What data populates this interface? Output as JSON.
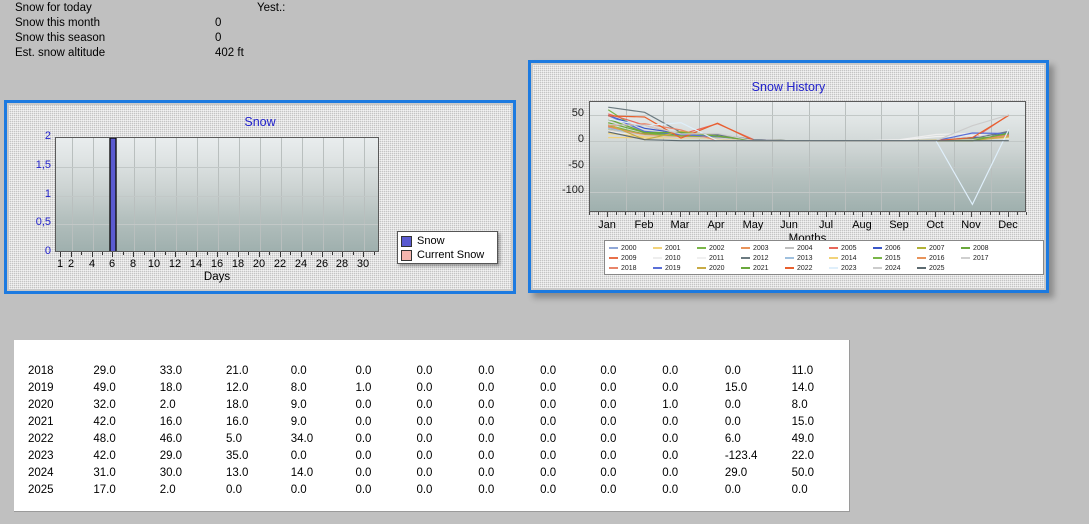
{
  "summary": {
    "rows": [
      {
        "label": "Snow for today",
        "value": "",
        "extra": "Yest.:"
      },
      {
        "label": "Snow this month",
        "value": "0",
        "extra": ""
      },
      {
        "label": "Snow this season",
        "value": "0",
        "extra": ""
      },
      {
        "label": "Est. snow altitude",
        "value": "402 ft",
        "extra": ""
      }
    ]
  },
  "snow_panel": {
    "title": "Snow",
    "legend": [
      {
        "label": "Snow",
        "color": "#5a5ad0"
      },
      {
        "label": "Current Snow",
        "color": "#f3b5ae"
      }
    ]
  },
  "history_panel": {
    "title": "Snow History"
  },
  "chart_data": [
    {
      "type": "bar",
      "title": "Snow",
      "xlabel": "Days",
      "ylabel": "",
      "ylim": [
        0,
        2
      ],
      "yticks": [
        "0",
        "0,5",
        "1",
        "1,5",
        "2"
      ],
      "ytick_values": [
        0,
        0.5,
        1,
        1.5,
        2
      ],
      "xticks": [
        "1",
        "2",
        "4",
        "6",
        "8",
        "10",
        "12",
        "14",
        "16",
        "18",
        "20",
        "22",
        "24",
        "26",
        "28",
        "30"
      ],
      "xtick_values": [
        1,
        2,
        4,
        6,
        8,
        10,
        12,
        14,
        16,
        18,
        20,
        22,
        24,
        26,
        28,
        30
      ],
      "categories": [
        1,
        2,
        3,
        4,
        5,
        6,
        7,
        8,
        9,
        10,
        11,
        12,
        13,
        14,
        15,
        16,
        17,
        18,
        19,
        20,
        21,
        22,
        23,
        24,
        25,
        26,
        27,
        28,
        29,
        30,
        31
      ],
      "series": [
        {
          "name": "Snow",
          "color": "#5a5ad0",
          "values": [
            0,
            0,
            0,
            0,
            0,
            2,
            0,
            0,
            0,
            0,
            0,
            0,
            0,
            0,
            0,
            0,
            0,
            0,
            0,
            0,
            0,
            0,
            0,
            0,
            0,
            0,
            0,
            0,
            0,
            0,
            0
          ]
        },
        {
          "name": "Current Snow",
          "color": "#f3b5ae",
          "values": [
            0,
            0,
            0,
            0,
            0,
            0,
            0,
            0,
            0,
            0,
            0,
            0,
            0,
            0,
            0,
            0,
            0,
            0,
            0,
            0,
            0,
            0,
            0,
            0,
            0,
            0,
            0,
            0,
            0,
            0,
            0
          ]
        }
      ],
      "grid": true,
      "legend_position": "right"
    },
    {
      "type": "line",
      "title": "Snow History",
      "xlabel": "Months",
      "ylabel": "",
      "ylim": [
        -140,
        75
      ],
      "yticks": [
        "50",
        "0",
        "-50",
        "-100"
      ],
      "ytick_values": [
        50,
        0,
        -50,
        -100
      ],
      "categories": [
        "Jan",
        "Feb",
        "Mar",
        "Apr",
        "May",
        "Jun",
        "Jul",
        "Aug",
        "Sep",
        "Oct",
        "Nov",
        "Dec"
      ],
      "grid": true,
      "legend_position": "bottom",
      "series": [
        {
          "name": "2000",
          "color": "#8fa8d8",
          "values": [
            26,
            12,
            8,
            6,
            2,
            0,
            0,
            0,
            0,
            0,
            0,
            9
          ]
        },
        {
          "name": "2001",
          "color": "#f2d37a",
          "values": [
            6,
            6,
            5,
            4,
            1,
            0,
            0,
            0,
            0,
            0,
            2,
            6
          ]
        },
        {
          "name": "2002",
          "color": "#7ab648",
          "values": [
            60,
            14,
            9,
            7,
            2,
            0,
            0,
            0,
            0,
            0,
            3,
            12
          ]
        },
        {
          "name": "2003",
          "color": "#e8935a",
          "values": [
            30,
            10,
            7,
            6,
            1,
            0,
            0,
            0,
            0,
            0,
            2,
            8
          ]
        },
        {
          "name": "2004",
          "color": "#bfbfbf",
          "values": [
            40,
            18,
            10,
            8,
            2,
            0,
            0,
            0,
            0,
            0,
            4,
            14
          ]
        },
        {
          "name": "2005",
          "color": "#e8675a",
          "values": [
            52,
            30,
            12,
            33,
            2,
            0,
            0,
            0,
            0,
            0,
            3,
            50
          ]
        },
        {
          "name": "2006",
          "color": "#3a56c8",
          "values": [
            49,
            24,
            14,
            10,
            2,
            0,
            0,
            0,
            0,
            0,
            6,
            16
          ]
        },
        {
          "name": "2007",
          "color": "#b2b235",
          "values": [
            22,
            12,
            9,
            8,
            1,
            0,
            0,
            0,
            0,
            0,
            2,
            10
          ]
        },
        {
          "name": "2008",
          "color": "#6aa83c",
          "values": [
            35,
            16,
            11,
            9,
            2,
            0,
            0,
            0,
            0,
            0,
            3,
            13
          ]
        },
        {
          "name": "2009",
          "color": "#e8704a",
          "values": [
            28,
            13,
            6,
            5,
            1,
            0,
            0,
            0,
            0,
            0,
            2,
            9
          ]
        },
        {
          "name": "2010",
          "color": "#eeeeee",
          "values": [
            18,
            10,
            6,
            4,
            1,
            0,
            0,
            0,
            2,
            12,
            14,
            4
          ]
        },
        {
          "name": "2011",
          "color": "#f0f0f0",
          "values": [
            20,
            8,
            5,
            4,
            1,
            0,
            0,
            0,
            1,
            8,
            10,
            5
          ]
        },
        {
          "name": "2012",
          "color": "#6b7a80",
          "values": [
            65,
            55,
            16,
            12,
            2,
            0,
            0,
            0,
            0,
            0,
            4,
            18
          ]
        },
        {
          "name": "2013",
          "color": "#9fc0de",
          "values": [
            24,
            10,
            7,
            6,
            1,
            0,
            0,
            0,
            0,
            0,
            2,
            7
          ]
        },
        {
          "name": "2014",
          "color": "#f2d37a",
          "values": [
            14,
            8,
            5,
            4,
            1,
            0,
            0,
            0,
            0,
            0,
            2,
            6
          ]
        },
        {
          "name": "2015",
          "color": "#7ab648",
          "values": [
            30,
            12,
            8,
            6,
            1,
            0,
            0,
            0,
            0,
            0,
            3,
            11
          ]
        },
        {
          "name": "2016",
          "color": "#e8935a",
          "values": [
            27,
            11,
            7,
            5,
            1,
            0,
            0,
            0,
            0,
            0,
            2,
            9
          ]
        },
        {
          "name": "2017",
          "color": "#cfcfcf",
          "values": [
            21,
            10,
            6,
            5,
            1,
            0,
            0,
            0,
            0,
            0,
            2,
            8
          ]
        },
        {
          "name": "2018",
          "color": "#e8856a",
          "values": [
            29,
            33,
            21,
            0,
            0,
            0,
            0,
            0,
            0,
            0,
            0,
            11
          ]
        },
        {
          "name": "2019",
          "color": "#5a6fd8",
          "values": [
            49,
            18,
            12,
            8,
            1,
            0,
            0,
            0,
            0,
            0,
            15,
            14
          ]
        },
        {
          "name": "2020",
          "color": "#c8ab45",
          "values": [
            32,
            2,
            18,
            9,
            0,
            0,
            0,
            0,
            0,
            1,
            0,
            8
          ]
        },
        {
          "name": "2021",
          "color": "#6aa83c",
          "values": [
            42,
            16,
            16,
            9,
            0,
            0,
            0,
            0,
            0,
            0,
            0,
            15
          ]
        },
        {
          "name": "2022",
          "color": "#e8602e",
          "values": [
            48,
            46,
            5,
            34,
            0,
            0,
            0,
            0,
            0,
            0,
            6,
            49
          ]
        },
        {
          "name": "2023",
          "color": "#dfeffb",
          "values": [
            42,
            29,
            35,
            0,
            0,
            0,
            0,
            0,
            0,
            0,
            -123.4,
            22
          ]
        },
        {
          "name": "2024",
          "color": "#cccccc",
          "values": [
            31,
            30,
            13,
            14,
            0,
            0,
            0,
            0,
            0,
            0,
            29,
            50
          ]
        },
        {
          "name": "2025",
          "color": "#5c6a70",
          "values": [
            17,
            2,
            0,
            0,
            0,
            0,
            0,
            0,
            0,
            0,
            0,
            0
          ]
        }
      ]
    }
  ],
  "table": {
    "rows": [
      [
        "2018",
        "29.0",
        "33.0",
        "21.0",
        "0.0",
        "0.0",
        "0.0",
        "0.0",
        "0.0",
        "0.0",
        "0.0",
        "0.0",
        "11.0"
      ],
      [
        "2019",
        "49.0",
        "18.0",
        "12.0",
        "8.0",
        "1.0",
        "0.0",
        "0.0",
        "0.0",
        "0.0",
        "0.0",
        "15.0",
        "14.0"
      ],
      [
        "2020",
        "32.0",
        "2.0",
        "18.0",
        "9.0",
        "0.0",
        "0.0",
        "0.0",
        "0.0",
        "0.0",
        "1.0",
        "0.0",
        "8.0"
      ],
      [
        "2021",
        "42.0",
        "16.0",
        "16.0",
        "9.0",
        "0.0",
        "0.0",
        "0.0",
        "0.0",
        "0.0",
        "0.0",
        "0.0",
        "15.0"
      ],
      [
        "2022",
        "48.0",
        "46.0",
        "5.0",
        "34.0",
        "0.0",
        "0.0",
        "0.0",
        "0.0",
        "0.0",
        "0.0",
        "6.0",
        "49.0"
      ],
      [
        "2023",
        "42.0",
        "29.0",
        "35.0",
        "0.0",
        "0.0",
        "0.0",
        "0.0",
        "0.0",
        "0.0",
        "0.0",
        "-123.4",
        "22.0"
      ],
      [
        "2024",
        "31.0",
        "30.0",
        "13.0",
        "14.0",
        "0.0",
        "0.0",
        "0.0",
        "0.0",
        "0.0",
        "0.0",
        "29.0",
        "50.0"
      ],
      [
        "2025",
        "17.0",
        "2.0",
        "0.0",
        "0.0",
        "0.0",
        "0.0",
        "0.0",
        "0.0",
        "0.0",
        "0.0",
        "0.0",
        "0.0"
      ]
    ]
  },
  "colors": {
    "panel_border": "#1c7ae0",
    "title_text": "#2222cc",
    "page_bg": "#c0c0c0"
  }
}
